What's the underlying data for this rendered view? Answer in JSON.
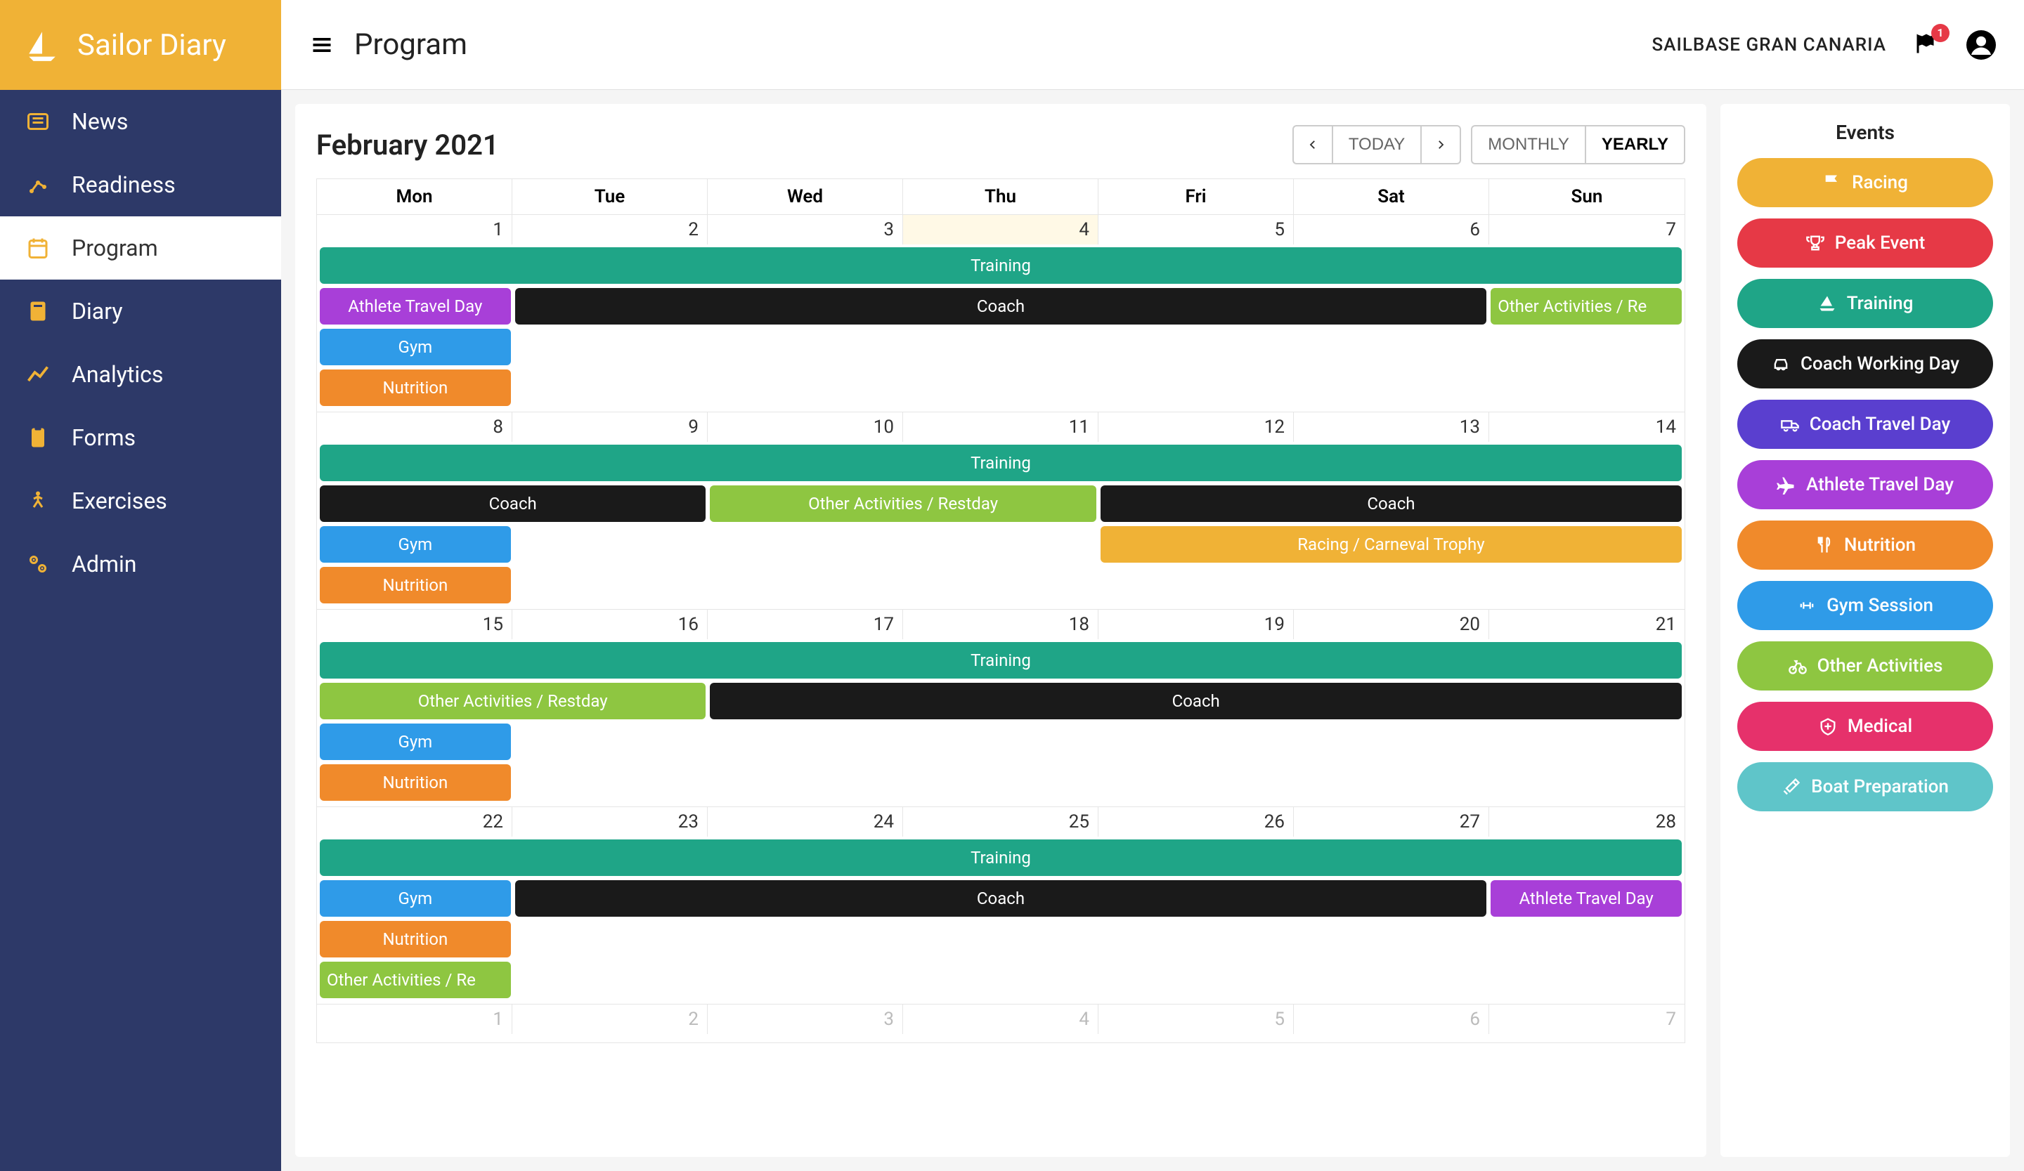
{
  "brand": {
    "name": "Sailor Diary"
  },
  "nav": {
    "items": [
      {
        "label": "News",
        "key": "news"
      },
      {
        "label": "Readiness",
        "key": "readiness"
      },
      {
        "label": "Program",
        "key": "program",
        "active": true
      },
      {
        "label": "Diary",
        "key": "diary"
      },
      {
        "label": "Analytics",
        "key": "analytics"
      },
      {
        "label": "Forms",
        "key": "forms"
      },
      {
        "label": "Exercises",
        "key": "exercises"
      },
      {
        "label": "Admin",
        "key": "admin"
      }
    ]
  },
  "topbar": {
    "page_title": "Program",
    "org": "SAILBASE GRAN CANARIA",
    "notification_count": "1"
  },
  "calendar": {
    "title": "February 2021",
    "controls": {
      "today": "TODAY",
      "monthly": "MONTHLY",
      "yearly": "YEARLY"
    },
    "day_headers": [
      "Mon",
      "Tue",
      "Wed",
      "Thu",
      "Fri",
      "Sat",
      "Sun"
    ],
    "weeks": [
      {
        "days": [
          {
            "num": "1"
          },
          {
            "num": "2"
          },
          {
            "num": "3"
          },
          {
            "num": "4",
            "today": true
          },
          {
            "num": "5"
          },
          {
            "num": "6"
          },
          {
            "num": "7"
          }
        ],
        "event_rows": [
          [
            {
              "label": "Training",
              "class": "c-training",
              "start": 1,
              "span": 7
            }
          ],
          [
            {
              "label": "Athlete Travel Day",
              "class": "c-athlete-travel",
              "start": 1,
              "span": 1
            },
            {
              "label": "Coach",
              "class": "c-coach",
              "start": 2,
              "span": 5
            },
            {
              "label": "Other Activities / Re",
              "class": "c-other",
              "start": 7,
              "span": 1,
              "left": true
            }
          ],
          [
            {
              "label": "Gym",
              "class": "c-gym",
              "start": 1,
              "span": 1
            }
          ],
          [
            {
              "label": "Nutrition",
              "class": "c-nutrition",
              "start": 1,
              "span": 1
            }
          ]
        ]
      },
      {
        "days": [
          {
            "num": "8"
          },
          {
            "num": "9"
          },
          {
            "num": "10"
          },
          {
            "num": "11"
          },
          {
            "num": "12"
          },
          {
            "num": "13"
          },
          {
            "num": "14"
          }
        ],
        "event_rows": [
          [
            {
              "label": "Training",
              "class": "c-training",
              "start": 1,
              "span": 7
            }
          ],
          [
            {
              "label": "Coach",
              "class": "c-coach",
              "start": 1,
              "span": 2
            },
            {
              "label": "Other Activities / Restday",
              "class": "c-other",
              "start": 3,
              "span": 2
            },
            {
              "label": "Coach",
              "class": "c-coach",
              "start": 5,
              "span": 3
            }
          ],
          [
            {
              "label": "Gym",
              "class": "c-gym",
              "start": 1,
              "span": 1
            },
            {
              "label": "Racing / Carneval Trophy",
              "class": "c-racing",
              "start": 5,
              "span": 3
            }
          ],
          [
            {
              "label": "Nutrition",
              "class": "c-nutrition",
              "start": 1,
              "span": 1
            }
          ]
        ]
      },
      {
        "days": [
          {
            "num": "15"
          },
          {
            "num": "16"
          },
          {
            "num": "17"
          },
          {
            "num": "18"
          },
          {
            "num": "19"
          },
          {
            "num": "20"
          },
          {
            "num": "21"
          }
        ],
        "event_rows": [
          [
            {
              "label": "Training",
              "class": "c-training",
              "start": 1,
              "span": 7
            }
          ],
          [
            {
              "label": "Other Activities / Restday",
              "class": "c-other",
              "start": 1,
              "span": 2
            },
            {
              "label": "Coach",
              "class": "c-coach",
              "start": 3,
              "span": 5
            }
          ],
          [
            {
              "label": "Gym",
              "class": "c-gym",
              "start": 1,
              "span": 1
            }
          ],
          [
            {
              "label": "Nutrition",
              "class": "c-nutrition",
              "start": 1,
              "span": 1
            }
          ]
        ]
      },
      {
        "days": [
          {
            "num": "22"
          },
          {
            "num": "23"
          },
          {
            "num": "24"
          },
          {
            "num": "25"
          },
          {
            "num": "26"
          },
          {
            "num": "27"
          },
          {
            "num": "28"
          }
        ],
        "event_rows": [
          [
            {
              "label": "Training",
              "class": "c-training",
              "start": 1,
              "span": 7
            }
          ],
          [
            {
              "label": "Gym",
              "class": "c-gym",
              "start": 1,
              "span": 1
            },
            {
              "label": "Coach",
              "class": "c-coach",
              "start": 2,
              "span": 5
            },
            {
              "label": "Athlete Travel Day",
              "class": "c-athlete-travel",
              "start": 7,
              "span": 1
            }
          ],
          [
            {
              "label": "Nutrition",
              "class": "c-nutrition",
              "start": 1,
              "span": 1
            }
          ],
          [
            {
              "label": "Other Activities / Re",
              "class": "c-other",
              "start": 1,
              "span": 1,
              "left": true
            }
          ]
        ]
      },
      {
        "days": [
          {
            "num": "1",
            "other": true
          },
          {
            "num": "2",
            "other": true
          },
          {
            "num": "3",
            "other": true
          },
          {
            "num": "4",
            "other": true
          },
          {
            "num": "5",
            "other": true
          },
          {
            "num": "6",
            "other": true
          },
          {
            "num": "7",
            "other": true
          }
        ],
        "event_rows": []
      }
    ]
  },
  "events_panel": {
    "title": "Events",
    "items": [
      {
        "label": "Racing",
        "class": "c-racing",
        "icon": "flag"
      },
      {
        "label": "Peak Event",
        "class": "c-peak",
        "icon": "trophy"
      },
      {
        "label": "Training",
        "class": "c-training",
        "icon": "sailboat"
      },
      {
        "label": "Coach Working Day",
        "class": "c-coach",
        "icon": "car"
      },
      {
        "label": "Coach Travel Day",
        "class": "c-coach-travel",
        "icon": "truck"
      },
      {
        "label": "Athlete Travel Day",
        "class": "c-athlete-travel",
        "icon": "plane"
      },
      {
        "label": "Nutrition",
        "class": "c-nutrition",
        "icon": "utensils"
      },
      {
        "label": "Gym Session",
        "class": "c-gym",
        "icon": "dumbbell"
      },
      {
        "label": "Other Activities",
        "class": "c-other",
        "icon": "bike"
      },
      {
        "label": "Medical",
        "class": "c-medical",
        "icon": "medical"
      },
      {
        "label": "Boat Preparation",
        "class": "c-boat",
        "icon": "tools"
      }
    ]
  }
}
